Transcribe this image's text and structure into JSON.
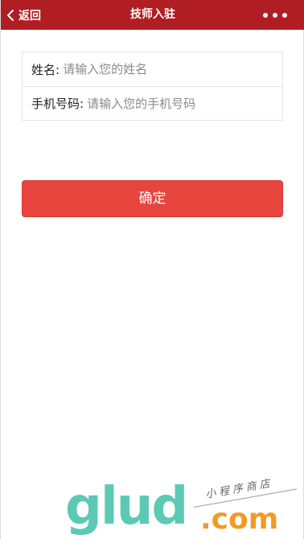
{
  "navbar": {
    "back_label": "返回",
    "title": "技师入驻",
    "back_icon": "chevron-left-icon",
    "more_icon": "more-dots-icon",
    "color": "#b01e23"
  },
  "form": {
    "name": {
      "label": "姓名:",
      "placeholder": "请输入您的姓名",
      "value": ""
    },
    "phone": {
      "label": "手机号码:",
      "placeholder": "请输入您的手机号码",
      "value": ""
    }
  },
  "confirm_button": {
    "label": "确定",
    "color": "#e8453f"
  },
  "watermark": {
    "brand": "glud",
    "suffix": ".com",
    "tagline": "小程序商店"
  }
}
